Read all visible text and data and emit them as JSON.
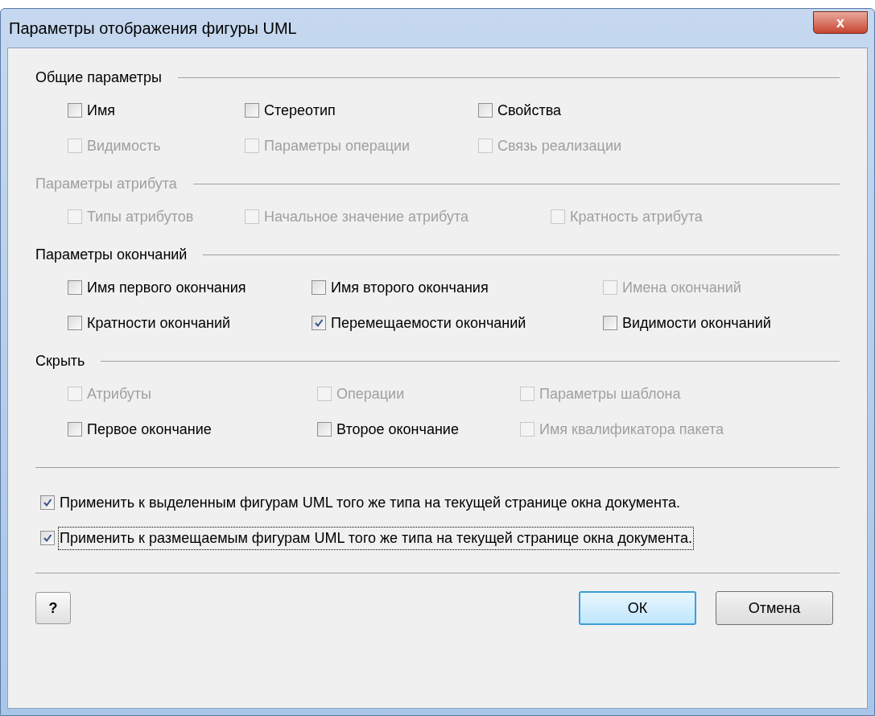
{
  "window": {
    "title": "Параметры отображения фигуры UML",
    "close": "x"
  },
  "sections": [
    {
      "title": "Общие параметры",
      "disabled": false,
      "items": [
        {
          "label": "Имя",
          "checked": false,
          "disabled": false
        },
        {
          "label": "Стереотип",
          "checked": false,
          "disabled": false
        },
        {
          "label": "Свойства",
          "checked": false,
          "disabled": false
        },
        {
          "label": "Видимость",
          "checked": false,
          "disabled": true
        },
        {
          "label": "Параметры операции",
          "checked": false,
          "disabled": true
        },
        {
          "label": "Связь реализации",
          "checked": false,
          "disabled": true
        }
      ]
    },
    {
      "title": "Параметры атрибута",
      "disabled": true,
      "items": [
        {
          "label": "Типы атрибутов",
          "checked": false,
          "disabled": true
        },
        {
          "label": "Начальное значение атрибута",
          "checked": false,
          "disabled": true
        },
        {
          "label": "Кратность атрибута",
          "checked": false,
          "disabled": true
        }
      ]
    },
    {
      "title": "Параметры окончаний",
      "disabled": false,
      "items": [
        {
          "label": "Имя первого окончания",
          "checked": false,
          "disabled": false
        },
        {
          "label": "Имя второго окончания",
          "checked": false,
          "disabled": false
        },
        {
          "label": "Имена окончаний",
          "checked": false,
          "disabled": true
        },
        {
          "label": "Кратности окончаний",
          "checked": false,
          "disabled": false
        },
        {
          "label": "Перемещаемости окончаний",
          "checked": true,
          "disabled": false
        },
        {
          "label": "Видимости окончаний",
          "checked": false,
          "disabled": false
        }
      ]
    },
    {
      "title": "Скрыть",
      "disabled": false,
      "items": [
        {
          "label": "Атрибуты",
          "checked": false,
          "disabled": true
        },
        {
          "label": "Операции",
          "checked": false,
          "disabled": true
        },
        {
          "label": "Параметры шаблона",
          "checked": false,
          "disabled": true
        },
        {
          "label": "Первое окончание",
          "checked": false,
          "disabled": false
        },
        {
          "label": "Второе окончание",
          "checked": false,
          "disabled": false
        },
        {
          "label": "Имя квалификатора пакета",
          "checked": false,
          "disabled": true
        }
      ]
    }
  ],
  "apply": [
    {
      "label": "Применить к выделенным фигурам UML того же типа на текущей странице окна документа.",
      "checked": true,
      "focused": false
    },
    {
      "label": "Применить к размещаемым фигурам UML того же типа на текущей странице окна документа.",
      "checked": true,
      "focused": true
    }
  ],
  "help": "?",
  "buttons": [
    {
      "label": "ОК",
      "default": true
    },
    {
      "label": "Отмена",
      "default": false
    }
  ]
}
